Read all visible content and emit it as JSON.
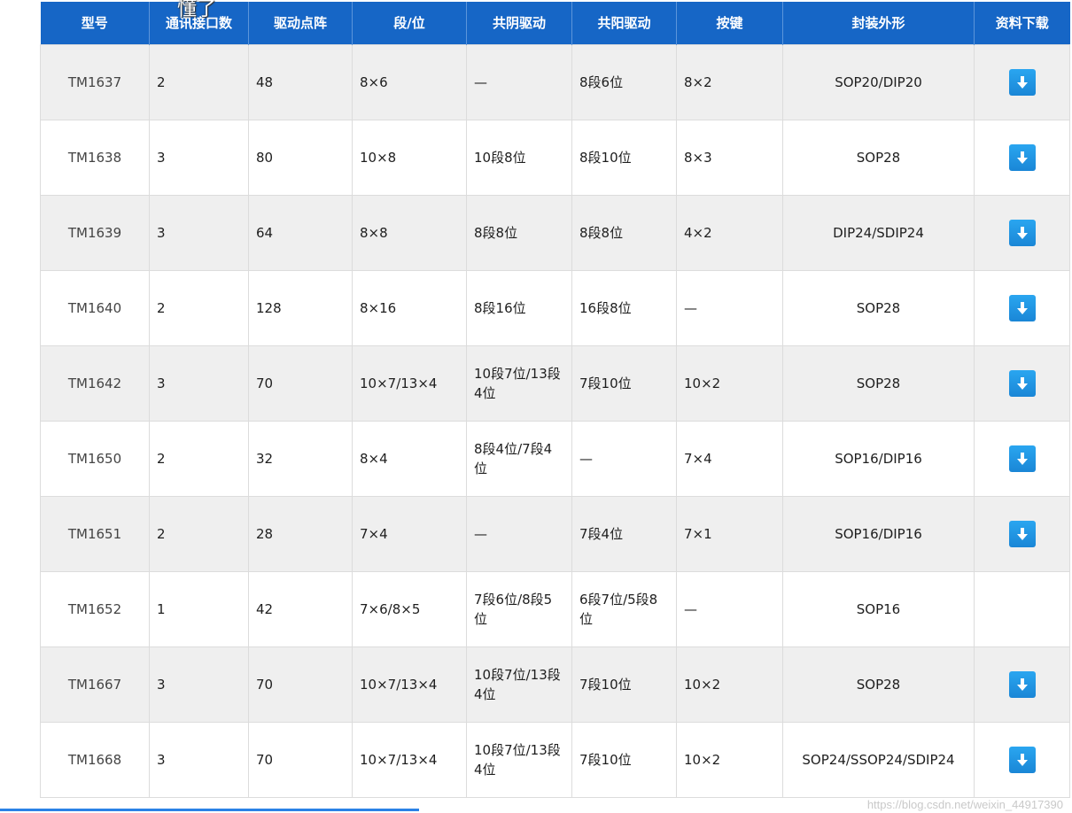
{
  "overlay_text": "懂了",
  "headers": [
    "型号",
    "通讯接口数",
    "驱动点阵",
    "段/位",
    "共阴驱动",
    "共阳驱动",
    "按键",
    "封装外形",
    "资料下载"
  ],
  "rows": [
    {
      "model": "TM1637",
      "iface": "2",
      "dots": "48",
      "segpos": "8×6",
      "cathode": "—",
      "anode": "8段6位",
      "keys": "8×2",
      "package": "SOP20/DIP20",
      "download": true
    },
    {
      "model": "TM1638",
      "iface": "3",
      "dots": "80",
      "segpos": "10×8",
      "cathode": "10段8位",
      "anode": "8段10位",
      "keys": "8×3",
      "package": "SOP28",
      "download": true
    },
    {
      "model": "TM1639",
      "iface": "3",
      "dots": "64",
      "segpos": "8×8",
      "cathode": "8段8位",
      "anode": "8段8位",
      "keys": "4×2",
      "package": "DIP24/SDIP24",
      "download": true
    },
    {
      "model": "TM1640",
      "iface": "2",
      "dots": "128",
      "segpos": "8×16",
      "cathode": "8段16位",
      "anode": "16段8位",
      "keys": "—",
      "package": "SOP28",
      "download": true
    },
    {
      "model": "TM1642",
      "iface": "3",
      "dots": "70",
      "segpos": "10×7/13×4",
      "cathode": "10段7位/13段4位",
      "anode": "7段10位",
      "keys": "10×2",
      "package": "SOP28",
      "download": true
    },
    {
      "model": "TM1650",
      "iface": "2",
      "dots": "32",
      "segpos": "8×4",
      "cathode": "8段4位/7段4位",
      "anode": "—",
      "keys": "7×4",
      "package": "SOP16/DIP16",
      "download": true
    },
    {
      "model": "TM1651",
      "iface": "2",
      "dots": "28",
      "segpos": "7×4",
      "cathode": "—",
      "anode": "7段4位",
      "keys": "7×1",
      "package": "SOP16/DIP16",
      "download": true
    },
    {
      "model": "TM1652",
      "iface": "1",
      "dots": "42",
      "segpos": "7×6/8×5",
      "cathode": "7段6位/8段5位",
      "anode": "6段7位/5段8位",
      "keys": "—",
      "package": "SOP16",
      "download": false
    },
    {
      "model": "TM1667",
      "iface": "3",
      "dots": "70",
      "segpos": "10×7/13×4",
      "cathode": "10段7位/13段4位",
      "anode": "7段10位",
      "keys": "10×2",
      "package": "SOP28",
      "download": true
    },
    {
      "model": "TM1668",
      "iface": "3",
      "dots": "70",
      "segpos": "10×7/13×4",
      "cathode": "10段7位/13段4位",
      "anode": "7段10位",
      "keys": "10×2",
      "package": "SOP24/SSOP24/SDIP24",
      "download": true
    }
  ],
  "watermark": "https://blog.csdn.net/weixin_44917390",
  "colors": {
    "header_bg": "#1666c6",
    "row_alt": "#efefef",
    "download_btn": "#1a86d6",
    "bottom_bar": "#2b82e6"
  }
}
